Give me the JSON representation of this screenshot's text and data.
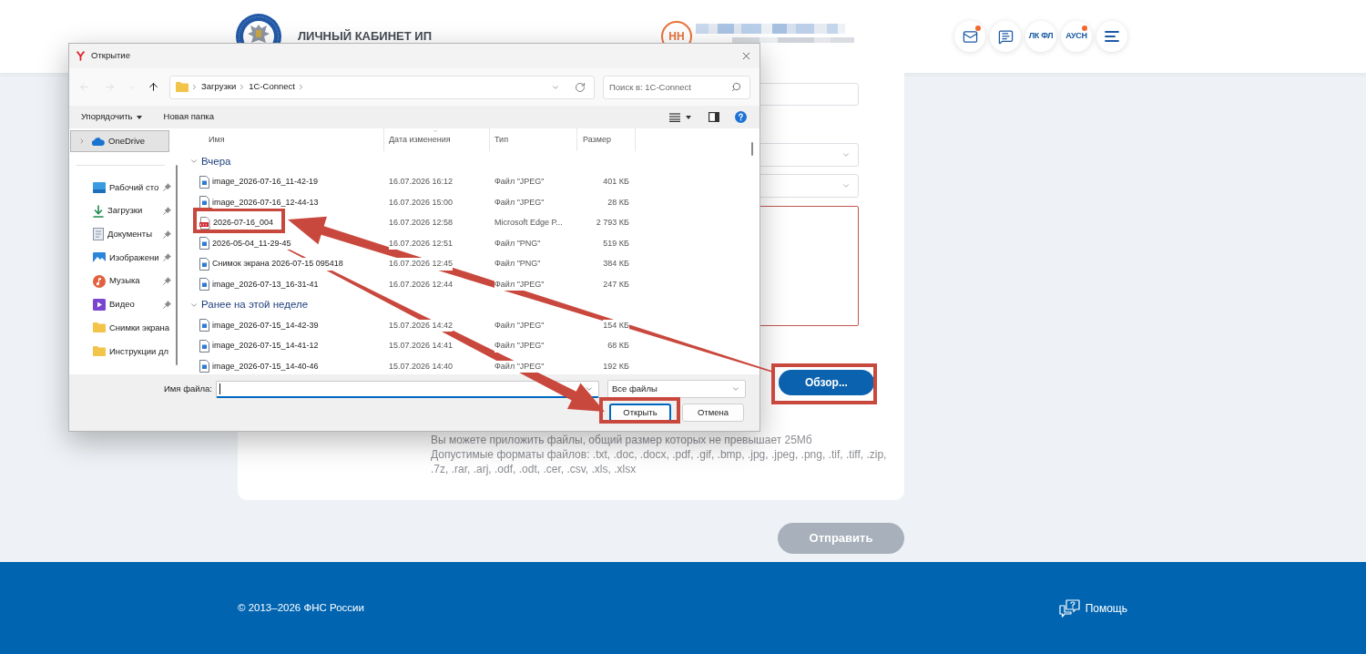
{
  "header": {
    "title": "ЛИЧНЫЙ КАБИНЕТ ИП",
    "avatar": "НН",
    "actions": [
      {
        "kind": "mail",
        "badge": true
      },
      {
        "kind": "chat",
        "badge": false
      },
      {
        "kind": "text",
        "label": "ЛК ФЛ",
        "badge": false
      },
      {
        "kind": "text",
        "label": "АУСН",
        "badge": true
      },
      {
        "kind": "menu",
        "badge": false
      }
    ]
  },
  "dialog": {
    "title": "Открытие",
    "nav": [
      {
        "kind": "back",
        "disabled": true
      },
      {
        "kind": "forward",
        "disabled": true
      },
      {
        "kind": "recent",
        "disabled": true
      },
      {
        "kind": "up",
        "disabled": false
      }
    ],
    "path": [
      "Загрузки",
      "1C-Connect"
    ],
    "search": {
      "placeholder": "Поиск в: 1C-Connect"
    },
    "toolbar": {
      "organize": "Упорядочить",
      "new_folder": "Новая папка"
    },
    "drive": {
      "label": "OneDrive",
      "selected": true,
      "expanded": false
    },
    "quick_access": [
      {
        "kind": "desktop",
        "label": "Рабочий сто",
        "selected": false,
        "pinned": true
      },
      {
        "kind": "downloads",
        "label": "Загрузки",
        "selected": false,
        "pinned": true
      },
      {
        "kind": "documents",
        "label": "Документы",
        "selected": false,
        "pinned": true
      },
      {
        "kind": "pictures",
        "label": "Изображени",
        "selected": false,
        "pinned": true
      },
      {
        "kind": "music",
        "label": "Музыка",
        "selected": false,
        "pinned": true
      },
      {
        "kind": "videos",
        "label": "Видео",
        "selected": false,
        "pinned": true
      },
      {
        "kind": "folder",
        "label": "Снимки экрана",
        "selected": false,
        "pinned": false
      },
      {
        "kind": "folder",
        "label": "Инструкции дл",
        "selected": false,
        "pinned": false
      }
    ],
    "columns": [
      {
        "label": "Имя",
        "sorted": false
      },
      {
        "label": "Дата изменения",
        "sorted": true
      },
      {
        "label": "Тип",
        "sorted": false
      },
      {
        "label": "Размер",
        "sorted": false
      }
    ],
    "groups": [
      {
        "label": "Вчера",
        "expanded": true,
        "rows": [
          {
            "kind": "image",
            "name": "image_2026-07-16_11-42-19",
            "date": "16.07.2026 16:12",
            "type": "Файл \"JPEG\"",
            "size": "401 КБ"
          },
          {
            "kind": "image",
            "name": "image_2026-07-16_12-44-13",
            "date": "16.07.2026 15:00",
            "type": "Файл \"JPEG\"",
            "size": "28 КБ"
          },
          {
            "kind": "pdf",
            "name": "2026-07-16_004",
            "date": "16.07.2026 12:58",
            "type": "Microsoft Edge P...",
            "size": "2 793 КБ"
          },
          {
            "kind": "image",
            "name": "2026-05-04_11-29-45",
            "date": "16.07.2026 12:51",
            "type": "Файл \"PNG\"",
            "size": "519 КБ"
          },
          {
            "kind": "image",
            "name": "Снимок экрана 2026-07-15 095418",
            "date": "16.07.2026 12:45",
            "type": "Файл \"PNG\"",
            "size": "384 КБ"
          },
          {
            "kind": "image",
            "name": "image_2026-07-13_16-31-41",
            "date": "16.07.2026 12:44",
            "type": "Файл \"JPEG\"",
            "size": "247 КБ"
          }
        ]
      },
      {
        "label": "Ранее на этой неделе",
        "expanded": true,
        "rows": [
          {
            "kind": "image",
            "name": "image_2026-07-15_14-42-39",
            "date": "15.07.2026 14:42",
            "type": "Файл \"JPEG\"",
            "size": "154 КБ"
          },
          {
            "kind": "image",
            "name": "image_2026-07-15_14-41-12",
            "date": "15.07.2026 14:41",
            "type": "Файл \"JPEG\"",
            "size": "68 КБ"
          },
          {
            "kind": "image",
            "name": "image_2026-07-15_14-40-46",
            "date": "15.07.2026 14:40",
            "type": "Файл \"JPEG\"",
            "size": "192 КБ"
          }
        ]
      }
    ],
    "file_name": {
      "label": "Имя файла:"
    },
    "filter": "Все файлы",
    "buttons": [
      {
        "label": "Открыть",
        "default": true
      },
      {
        "label": "Отмена",
        "default": false
      }
    ]
  },
  "form": {
    "fields": [
      {
        "kind": "input",
        "invalid": false
      },
      {
        "kind": "select",
        "invalid": false
      },
      {
        "kind": "select",
        "invalid": false
      },
      {
        "kind": "textarea",
        "invalid": true
      }
    ],
    "browse_button": "Обзор...",
    "hint": "Вы можете приложить файлы, общий размер которых не превышает 25Мб",
    "formats": "Допустимые форматы файлов: .txt, .doc, .docx, .pdf, .gif, .bmp, .jpg, .jpeg, .png, .tif, .tiff, .zip, .7z, .rar, .arj, .odf, .odt, .cer, .csv, .xls, .xlsx"
  },
  "send_button": {
    "label": "Отправить",
    "disabled": true
  },
  "footer": {
    "copyright": "© 2013–2026 ФНС России",
    "help": "Помощь"
  }
}
